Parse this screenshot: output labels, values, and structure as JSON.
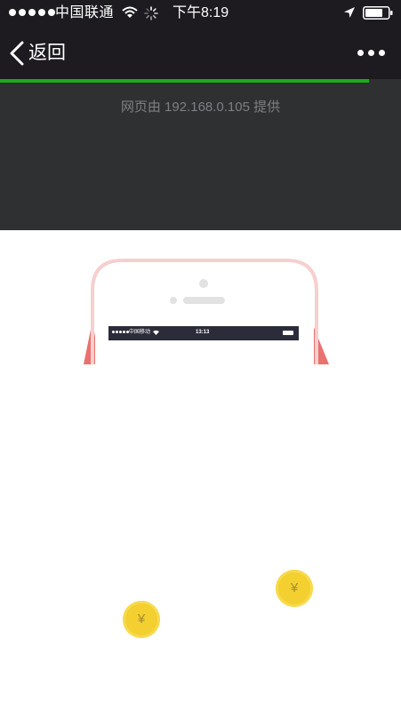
{
  "status_bar": {
    "carrier": "中国联通",
    "time": "下午8:19"
  },
  "nav": {
    "back_label": "返回",
    "load_progress": 0.92
  },
  "provider": {
    "text": "网页由 192.168.0.105 提供"
  },
  "illustration": {
    "mini_carrier": "中国移动",
    "mini_time": "13:13"
  },
  "coins": [
    {
      "symbol": "¥"
    },
    {
      "symbol": "¥"
    }
  ],
  "colors": {
    "nav_background": "#1d1b20",
    "progress": "#1aad19",
    "provider_background": "#2e3032",
    "coin": "#f3cf2f"
  }
}
